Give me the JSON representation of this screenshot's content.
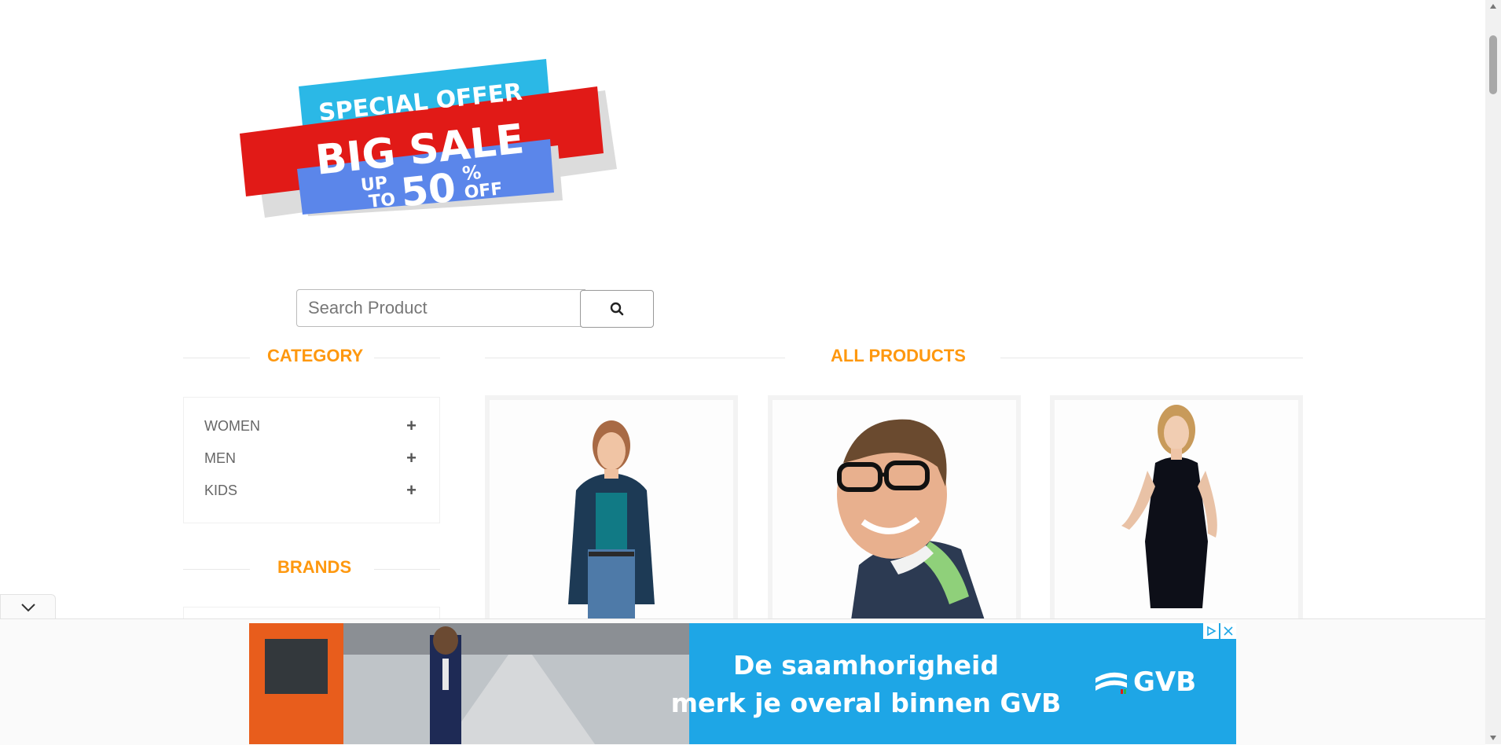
{
  "banner": {
    "line1": "SPECIAL OFFER",
    "line2": "BIG SALE",
    "line3_up": "UP",
    "line3_to": "TO",
    "line3_num": "50",
    "line3_pct": "%",
    "line3_off": "OFF",
    "colors": {
      "cyan": "#2BB8E6",
      "red": "#E11A17",
      "blue": "#5B86EA"
    }
  },
  "search": {
    "placeholder": "Search Product",
    "icon": "search-icon"
  },
  "sidebar": {
    "category_title": "CATEGORY",
    "categories": [
      {
        "label": "WOMEN",
        "icon": "plus-icon"
      },
      {
        "label": "MEN",
        "icon": "plus-icon"
      },
      {
        "label": "KIDS",
        "icon": "plus-icon"
      }
    ],
    "brands_title": "BRANDS"
  },
  "main": {
    "title": "ALL PRODUCTS",
    "products": [
      {
        "image": "woman-cardigan-photo"
      },
      {
        "image": "man-glasses-photo"
      },
      {
        "image": "woman-black-dress-photo"
      }
    ]
  },
  "ad": {
    "line1": "De saamhorigheid",
    "line2": "merk je overal binnen GVB",
    "brand": "GVB",
    "background": "#1EA6E6"
  },
  "accent_color": "#FE980F"
}
